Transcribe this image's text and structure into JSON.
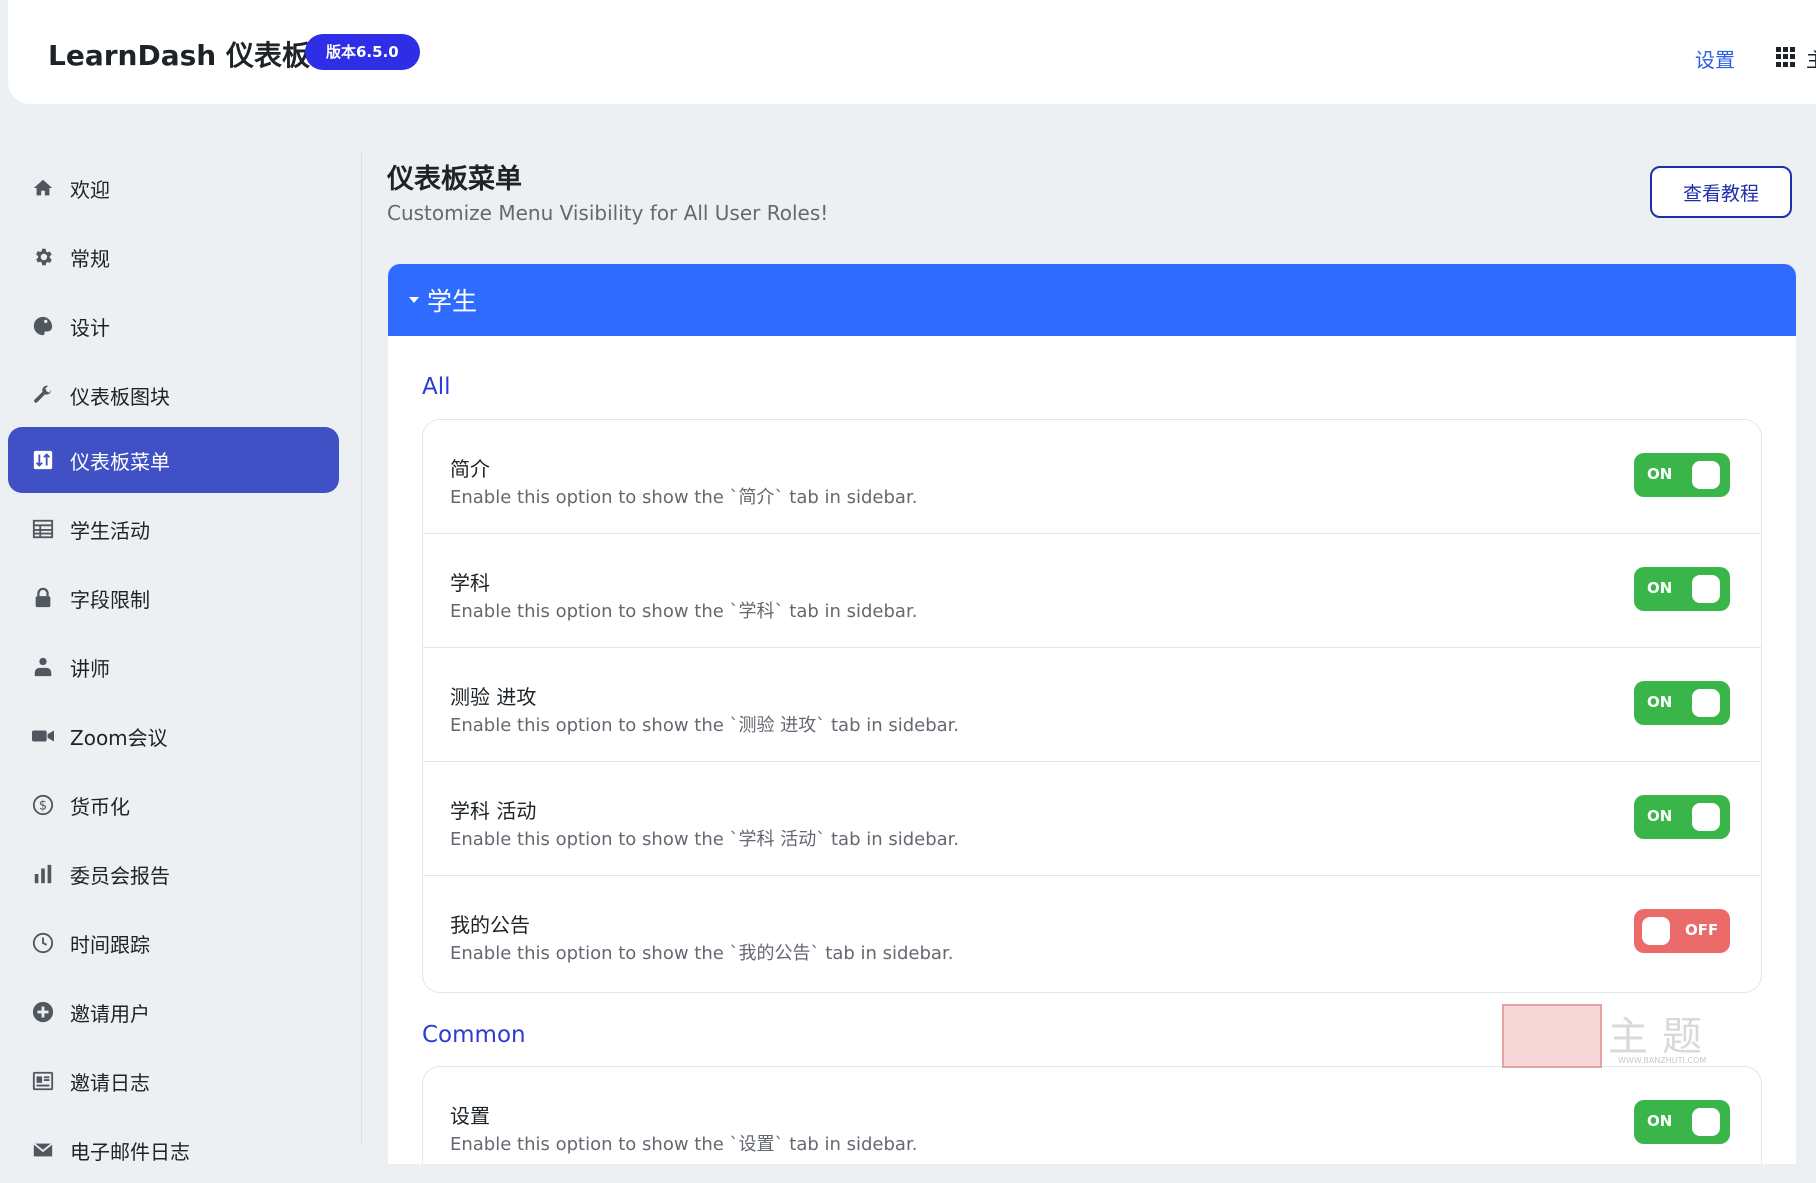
{
  "header": {
    "title": "LearnDash 仪表板",
    "version_badge": "版本6.5.0",
    "settings_link": "设置",
    "main_link": "主"
  },
  "sidebar": {
    "items": [
      {
        "label": "欢迎",
        "icon": "home-icon"
      },
      {
        "label": "常规",
        "icon": "gear-icon"
      },
      {
        "label": "设计",
        "icon": "palette-icon"
      },
      {
        "label": "仪表板图块",
        "icon": "wrench-icon"
      },
      {
        "label": "仪表板菜单",
        "icon": "menu-sort-icon",
        "active": true
      },
      {
        "label": "学生活动",
        "icon": "table-icon"
      },
      {
        "label": "字段限制",
        "icon": "lock-icon"
      },
      {
        "label": "讲师",
        "icon": "instructor-icon"
      },
      {
        "label": "Zoom会议",
        "icon": "video-icon"
      },
      {
        "label": "货币化",
        "icon": "dollar-icon"
      },
      {
        "label": "委员会报告",
        "icon": "bar-chart-icon"
      },
      {
        "label": "时间跟踪",
        "icon": "clock-icon"
      },
      {
        "label": "邀请用户",
        "icon": "plus-circle-icon"
      },
      {
        "label": "邀请日志",
        "icon": "id-card-icon"
      },
      {
        "label": "电子邮件日志",
        "icon": "mail-icon"
      }
    ]
  },
  "main": {
    "title": "仪表板菜单",
    "subtitle": "Customize Menu Visibility for All User Roles!",
    "tutorial_button": "查看教程",
    "panel_title": "学生",
    "groups": [
      {
        "label": "All",
        "rows": [
          {
            "title": "简介",
            "desc": "Enable this option to show the `简介` tab in sidebar.",
            "state": "ON"
          },
          {
            "title": "学科",
            "desc": "Enable this option to show the `学科` tab in sidebar.",
            "state": "ON"
          },
          {
            "title": "测验 进攻",
            "desc": "Enable this option to show the `测验 进攻` tab in sidebar.",
            "state": "ON"
          },
          {
            "title": "学科 活动",
            "desc": "Enable this option to show the `学科 活动` tab in sidebar.",
            "state": "ON"
          },
          {
            "title": "我的公告",
            "desc": "Enable this option to show the `我的公告` tab in sidebar.",
            "state": "OFF"
          }
        ]
      },
      {
        "label": "Common",
        "rows": [
          {
            "title": "设置",
            "desc": "Enable this option to show the `设置` tab in sidebar.",
            "state": "ON"
          }
        ]
      }
    ]
  },
  "watermark": {
    "chars": "主题",
    "url": "WWW.BANZHUTI.COM"
  },
  "colors": {
    "accent": "#2f6bff",
    "active_nav": "#3f51c4",
    "toggle_on": "#3ab54a",
    "toggle_off": "#eb6b6b",
    "badge": "#2e2ee6"
  }
}
